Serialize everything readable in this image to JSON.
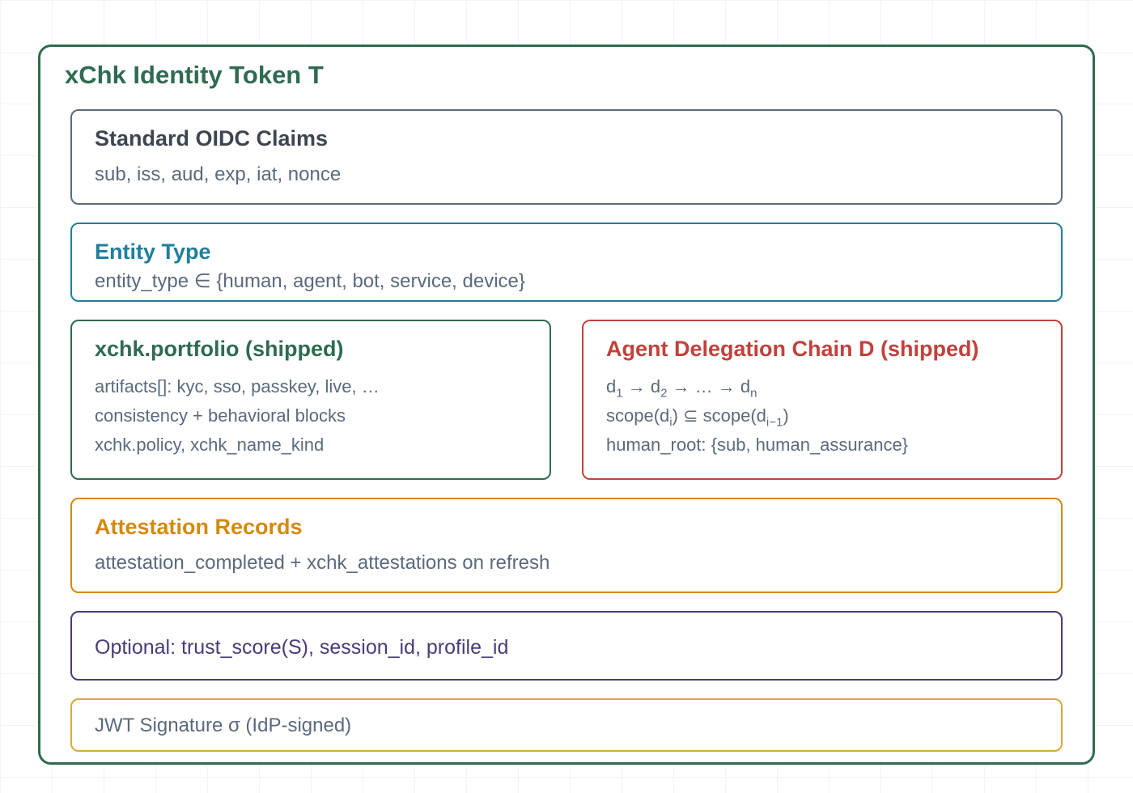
{
  "diagram": {
    "title": "xChk Identity Token T",
    "oidc": {
      "title": "Standard OIDC Claims",
      "claims": "sub, iss, aud, exp, iat, nonce"
    },
    "entity": {
      "title": "Entity Type",
      "definition": "entity_type ∈ {human, agent, bot, service, device}"
    },
    "portfolio": {
      "title": "xchk.portfolio (shipped)",
      "lines": [
        "artifacts[]: kyc, sso, passkey, live, …",
        "consistency + behavioral blocks",
        "xchk.policy, xchk_name_kind"
      ]
    },
    "delegation": {
      "title": "Agent Delegation Chain D (shipped)",
      "chain": {
        "d": "d",
        "first_sub": "1",
        "arrow1": " → ",
        "second_sub": "2",
        "middle": " → … → ",
        "last_sub": "n"
      },
      "scope": {
        "prefix": "scope(d",
        "sub_i": "i",
        "middle": ") ⊆ scope(d",
        "sub_prev": "i−1",
        "suffix": ")"
      },
      "human_root": "human_root: {sub, human_assurance}"
    },
    "attestation": {
      "title": "Attestation Records",
      "line": "attestation_completed + xchk_attestations on refresh"
    },
    "optional": {
      "line": "Optional: trust_score(S), session_id, profile_id"
    },
    "signature": {
      "line": "JWT Signature σ (IdP-signed)"
    },
    "colors": {
      "outer": "#2f6b50",
      "oidc": "#5c6b80",
      "entity": "#1f7f9c",
      "portfolio": "#2f6b50",
      "delegation": "#c2413b",
      "attestation": "#d4890e",
      "optional": "#4c3a78",
      "signature": "#d9a93d",
      "text": "#5a6a7d"
    }
  }
}
